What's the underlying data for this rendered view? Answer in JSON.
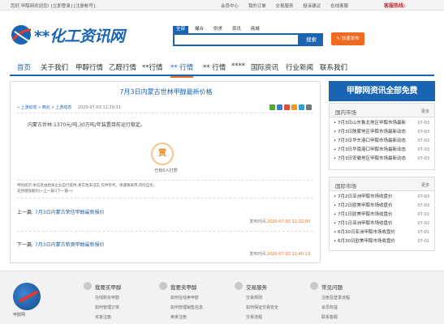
{
  "topbar": {
    "welcome": "您好,甲醇网欢迎您!",
    "login": "[立即登录]",
    "register": "[注册帐号]",
    "links": [
      "会员中心",
      "我的订单",
      "交易服务",
      "投诉建议",
      "在线客服"
    ],
    "hotline": "客服热线:"
  },
  "header": {
    "logo_text": "**化工资讯网",
    "search_tabs": [
      "全部",
      "撮合",
      "供求",
      "资讯",
      "商城"
    ],
    "search_placeholder": "",
    "search_button": "搜索",
    "publish_button": "快速发布"
  },
  "nav": {
    "items": [
      "首页",
      "关于我们",
      "甲醇行情",
      "乙醛行情",
      "**行情",
      "** 行情",
      "** 行情",
      "****",
      "国际资讯",
      "行业新闻",
      "联系我们"
    ]
  },
  "article": {
    "title": "7月3日内蒙古世林甲醇最新价格",
    "breadcrumb": [
      "上游动态",
      "西北",
      "上游动态"
    ],
    "date": "2020-07-03 11:29:31",
    "content": "内蒙古世林:1370元/吨,30万吨/年装置目前运行稳定。",
    "reward_icon": "赏",
    "reward_count": "已有0人打赏",
    "notice_lines": [
      "特别提示:本信息由相关企业自行提供,真实性未证实,仅供参考。请谨慎采用,风险自负。",
      "支持键盘翻页(←上一篇)(下一篇→)"
    ],
    "prev_label": "上一篇:",
    "prev_title": "7月3日内蒙古荣信甲醇最新报价",
    "prev_time_label": "发布时间:",
    "prev_time": "2020-07-03 11:32:00",
    "next_label": "下一篇:",
    "next_title": "7月3日内蒙古新奥甲醇最新报价",
    "next_time_label": "发布时间:",
    "next_time": "2020-07-03 11:40:13"
  },
  "sidebar": {
    "banner": "甲醇网资讯全部免费",
    "domestic": {
      "title": "国内市场",
      "more": "更多",
      "items": [
        {
          "text": "• 7月3日山东鲁北地区甲醇市场最新",
          "date": "07-03"
        },
        {
          "text": "• 7月3日陕蒙地区甲醇市场最新动态",
          "date": "07-03"
        },
        {
          "text": "• 7月3日华东港口甲醇市场最新动态",
          "date": "07-03"
        },
        {
          "text": "• 7月3日华南港口甲醇市场最新动态",
          "date": "07-03"
        },
        {
          "text": "• 7月3日安徽地区甲醇市场最新动态",
          "date": "07-03"
        }
      ]
    },
    "international": {
      "title": "国际市场",
      "more": "更多",
      "items": [
        {
          "text": "• 7月2日亚洲甲醇市场收盘价",
          "date": "07-03"
        },
        {
          "text": "• 7月2日欧美甲醇市场收盘价",
          "date": "07-03"
        },
        {
          "text": "• 7月1日欧美甲醇市场收盘价",
          "date": "07-02"
        },
        {
          "text": "• 7月1日亚洲甲醇市场收盘价",
          "date": "07-02"
        },
        {
          "text": "• 6月30日亚洲甲醇市场收盘价",
          "date": "07-01"
        },
        {
          "text": "• 6月30日欧美甲醇市场收盘价",
          "date": "07-01"
        }
      ]
    }
  },
  "footer": {
    "logo_name": "甲醇网",
    "columns": [
      {
        "title": "我要买甲醇",
        "items": [
          "在线购买甲醇",
          "如何管理订单",
          "买家注册"
        ]
      },
      {
        "title": "我要卖甲醇",
        "items": [
          "如何在线卖甲醇",
          "如何管理销售信息",
          "卖家注册"
        ]
      },
      {
        "title": "交易服务",
        "items": [
          "交易规则",
          "如何保证交易安全",
          "交易流程"
        ]
      },
      {
        "title": "常见问题",
        "items": [
          "注册及登录流程",
          "会员权益",
          "联系客服"
        ]
      }
    ]
  },
  "colors": {
    "brand_blue": "#1a65b3",
    "accent_orange": "#f06b22",
    "hotline_red": "#c1272d"
  }
}
